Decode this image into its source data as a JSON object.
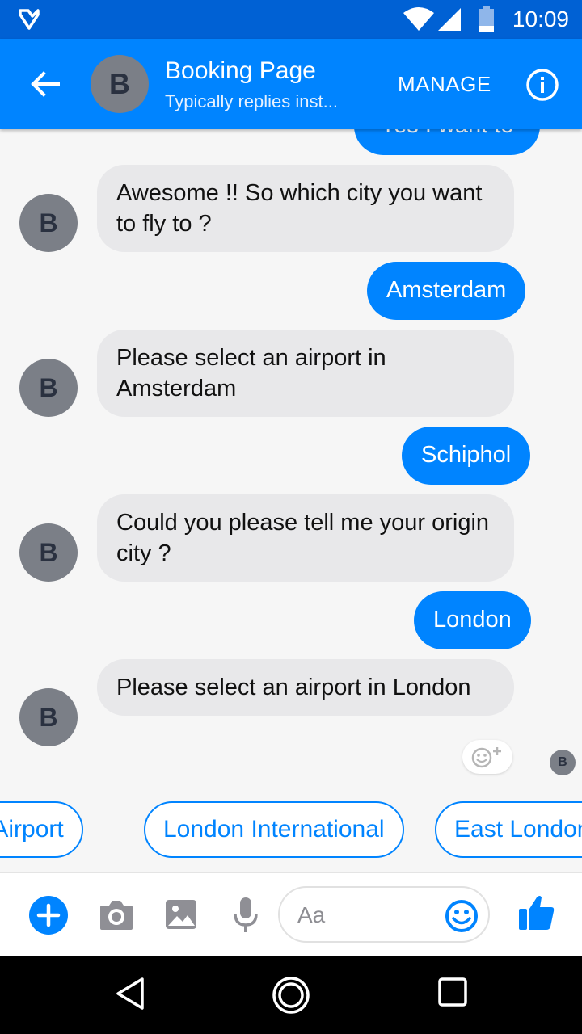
{
  "status_bar": {
    "time": "10:09",
    "icons": [
      "app-notification-icon",
      "wifi-icon",
      "signal-icon",
      "battery-icon"
    ]
  },
  "header": {
    "avatar_letter": "B",
    "title": "Booking Page",
    "subtitle": "Typically replies inst...",
    "manage_label": "MANAGE",
    "icons": [
      "back-arrow-icon",
      "info-icon"
    ],
    "color": "#0084ff"
  },
  "conversation": {
    "partial_message": "Yes I want to",
    "messages": [
      {
        "from": "page",
        "avatar": "B",
        "text": "Awesome !! So which city you want to fly to ?"
      },
      {
        "from": "me",
        "text": "Amsterdam"
      },
      {
        "from": "page",
        "avatar": "B",
        "text": "Please select an airport in Amsterdam"
      },
      {
        "from": "me",
        "text": "Schiphol"
      },
      {
        "from": "page",
        "avatar": "B",
        "text": "Could you please tell me your origin city ?"
      },
      {
        "from": "me",
        "text": "London"
      },
      {
        "from": "page",
        "avatar": "B",
        "text": "Please select an airport in London"
      }
    ],
    "seen_avatar": "B"
  },
  "quick_replies": [
    "City Airport",
    "London International",
    "East London"
  ],
  "composer": {
    "placeholder": "Aa",
    "icons": [
      "plus-icon",
      "camera-icon",
      "image-icon",
      "microphone-icon",
      "emoji-icon",
      "thumbs-up-icon"
    ]
  },
  "nav_bar": {
    "icons": [
      "back-triangle-icon",
      "home-circle-icon",
      "recents-square-icon"
    ]
  }
}
